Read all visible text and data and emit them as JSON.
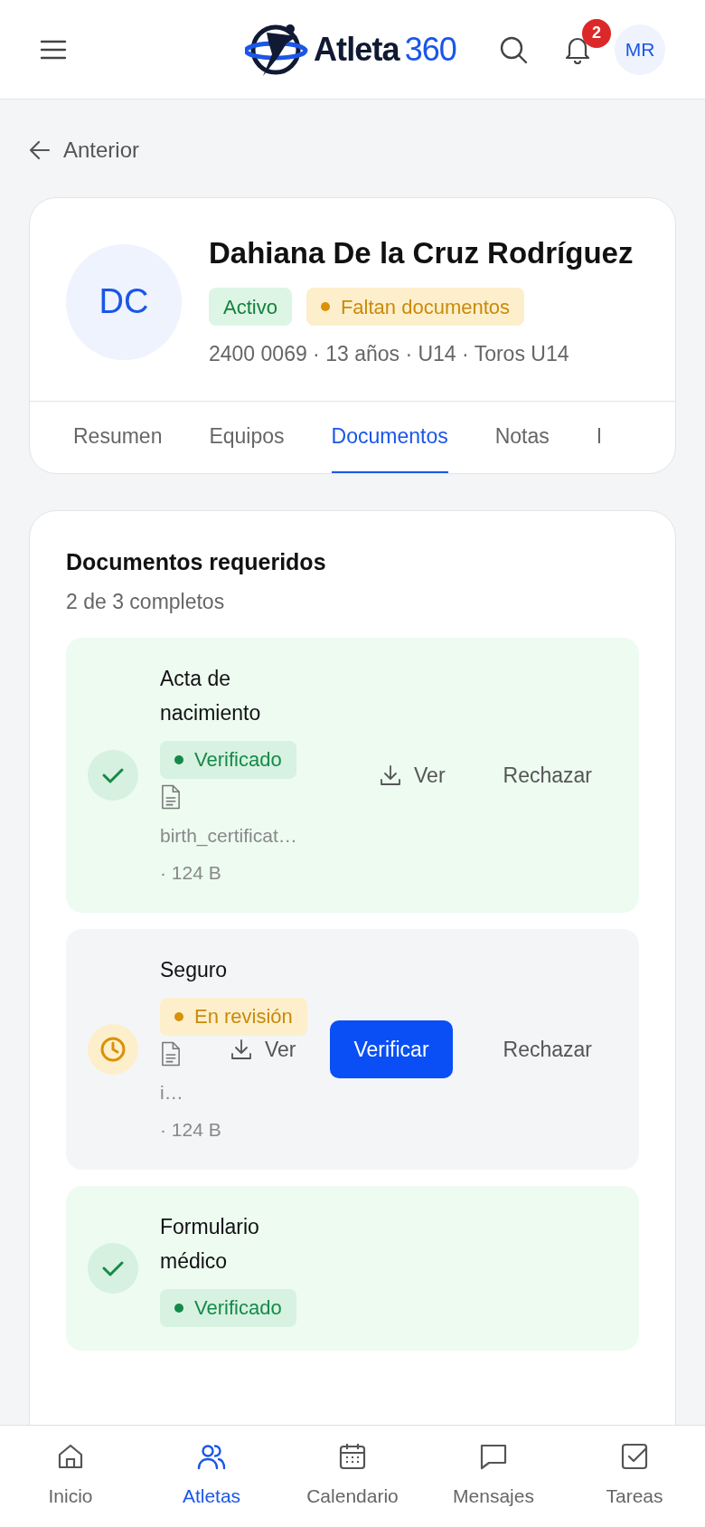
{
  "header": {
    "logo_word": "Atleta",
    "logo_number": "360",
    "notification_count": "2",
    "avatar": "MR"
  },
  "back": "Anterior",
  "profile": {
    "initials": "DC",
    "name": "Dahiana De la Cruz Rodríguez",
    "badges": [
      {
        "label": "Activo",
        "kind": "success",
        "dot": false
      },
      {
        "label": "Faltan documentos",
        "kind": "warning",
        "dot": true
      }
    ],
    "meta": "2400 0069 · 13 años · U14 · Toros U14",
    "tabs": [
      {
        "label": "Resumen",
        "selected": false
      },
      {
        "label": "Equipos",
        "selected": false
      },
      {
        "label": "Documentos",
        "selected": true
      },
      {
        "label": "Notas",
        "selected": false
      },
      {
        "label": "I",
        "selected": false
      }
    ]
  },
  "documents": {
    "title": "Documentos requeridos",
    "summary": "2 de 3 completos",
    "items": [
      {
        "title": "Acta de nacimiento",
        "kind": "verified",
        "badge": "Verificado",
        "filename": "birth_certificat…",
        "size": "· 124 B",
        "actions": [
          {
            "label": "Ver",
            "kind": "download"
          },
          {
            "label": "Rechazar",
            "kind": "plain"
          }
        ]
      },
      {
        "title": "Seguro",
        "kind": "review",
        "badge": "En revisión",
        "filename": "i…",
        "size": "· 124 B",
        "actions": [
          {
            "label": "Ver",
            "kind": "download"
          },
          {
            "label": "Verificar",
            "kind": "primary"
          },
          {
            "label": "Rechazar",
            "kind": "plain"
          }
        ]
      },
      {
        "title": "Formulario médico",
        "kind": "verified",
        "badge": "Verificado"
      }
    ]
  },
  "nav": [
    {
      "label": "Inicio",
      "selected": false
    },
    {
      "label": "Atletas",
      "selected": true
    },
    {
      "label": "Calendario",
      "selected": false
    },
    {
      "label": "Mensajes",
      "selected": false
    },
    {
      "label": "Tareas",
      "selected": false
    }
  ]
}
